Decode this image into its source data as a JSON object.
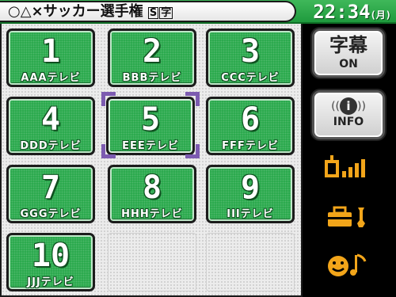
{
  "header": {
    "title": "○△×サッカー選手権",
    "title_badges": [
      "S",
      "字"
    ],
    "clock_time": "22:34",
    "clock_day": "(月)"
  },
  "channels": [
    {
      "number": "1",
      "name": "AAAテレビ"
    },
    {
      "number": "2",
      "name": "BBBテレビ"
    },
    {
      "number": "3",
      "name": "CCCテレビ"
    },
    {
      "number": "4",
      "name": "DDDテレビ"
    },
    {
      "number": "5",
      "name": "EEEテレビ",
      "selected": true
    },
    {
      "number": "6",
      "name": "FFFテレビ"
    },
    {
      "number": "7",
      "name": "GGGテレビ"
    },
    {
      "number": "8",
      "name": "HHHテレビ"
    },
    {
      "number": "9",
      "name": "IIIテレビ"
    },
    {
      "number": "10",
      "name": "JJJテレビ"
    }
  ],
  "side": {
    "subtitle_button": {
      "label": "字幕",
      "state": "ON"
    },
    "info_button": {
      "label": "INFO",
      "icon": "info-icon"
    },
    "signal_icon": "signal-strength-icon",
    "tools_icon": "toolbox-wrench-icon",
    "smile_icon": "smiley-note-icon"
  },
  "colors": {
    "tile_green": "#27a84a",
    "selection": "#7c5bb0",
    "icon_orange": "#f2a51a"
  }
}
